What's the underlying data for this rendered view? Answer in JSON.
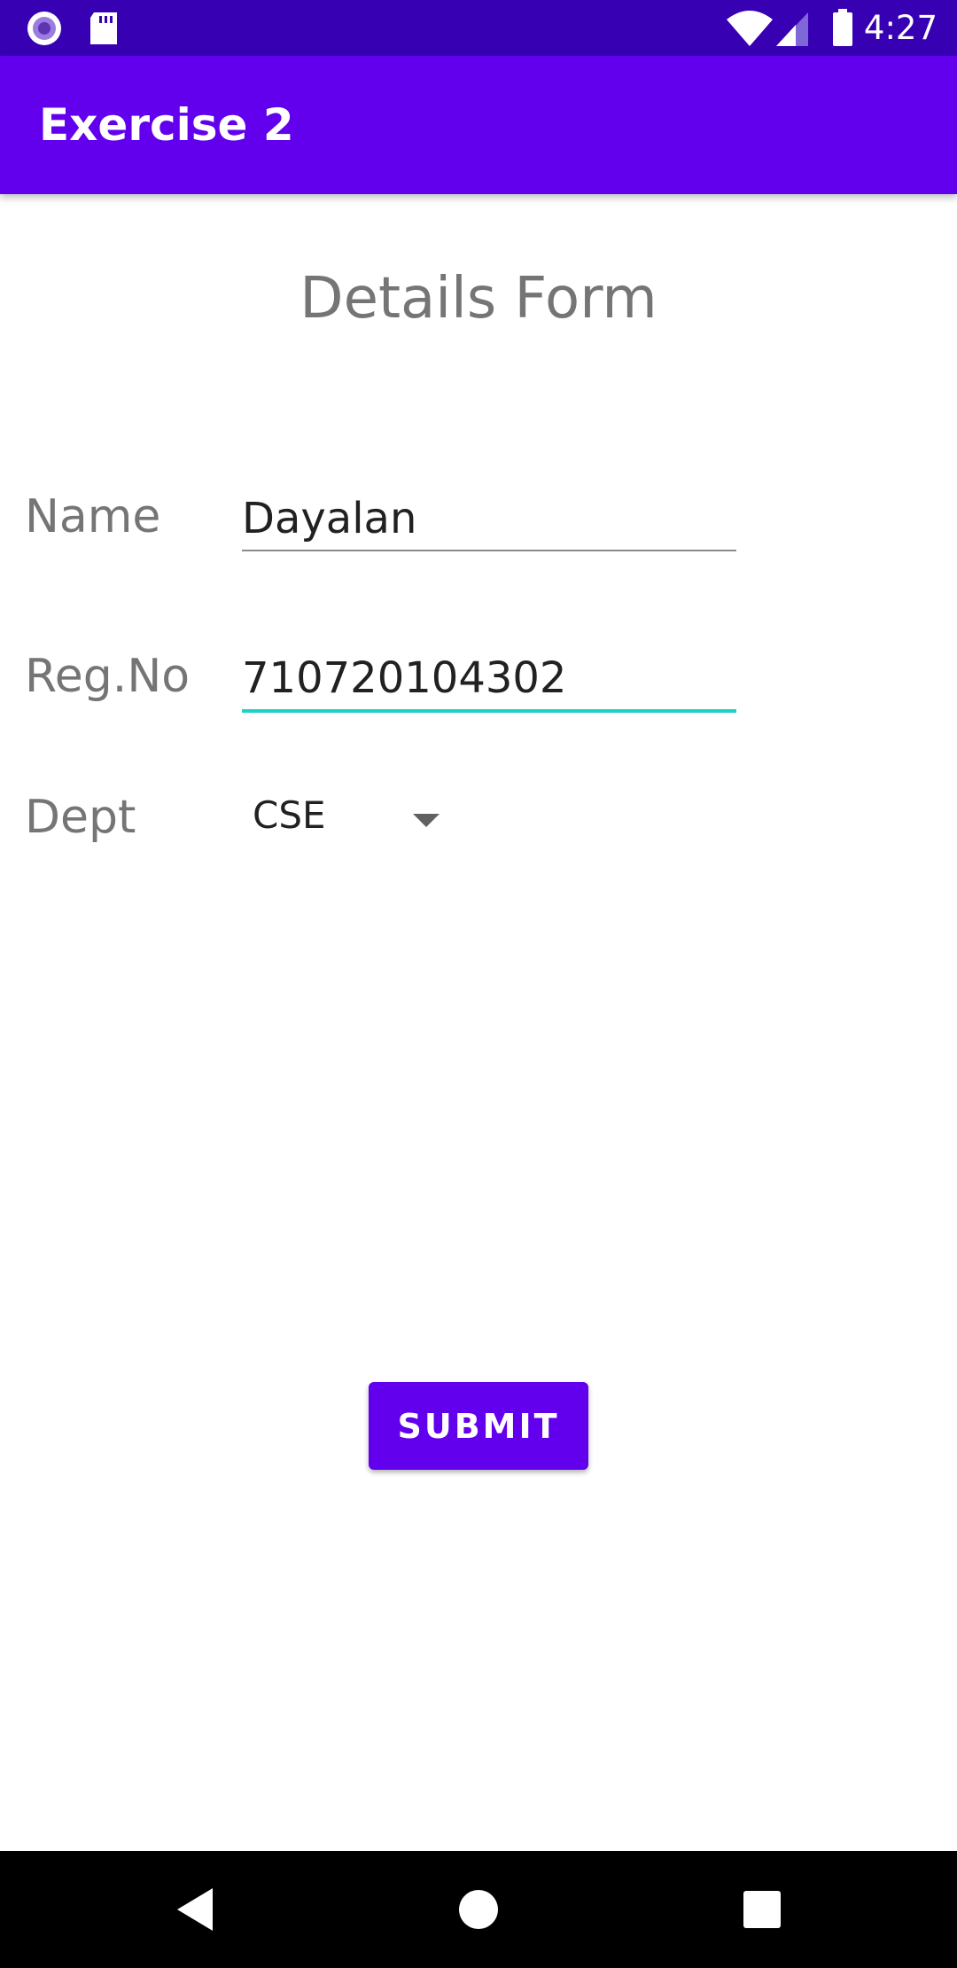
{
  "status_bar": {
    "time": "4:27",
    "icons": [
      "radio-notification-icon",
      "sd-card-icon",
      "wifi-icon",
      "cell-signal-icon",
      "battery-icon"
    ]
  },
  "app_bar": {
    "title": "Exercise 2"
  },
  "form": {
    "title": "Details Form",
    "name": {
      "label": "Name",
      "value": "Dayalan"
    },
    "reg_no": {
      "label": "Reg.No",
      "value": "710720104302"
    },
    "dept": {
      "label": "Dept",
      "selected": "CSE"
    },
    "submit_label": "SUBMIT"
  },
  "nav_bar": {
    "icons": [
      "back-icon",
      "home-icon",
      "recents-icon"
    ]
  },
  "colors": {
    "status_bar": "#3700B3",
    "primary": "#6200EE",
    "focus_accent": "#1FD0C8",
    "label_gray": "#757575",
    "text": "#212121"
  }
}
